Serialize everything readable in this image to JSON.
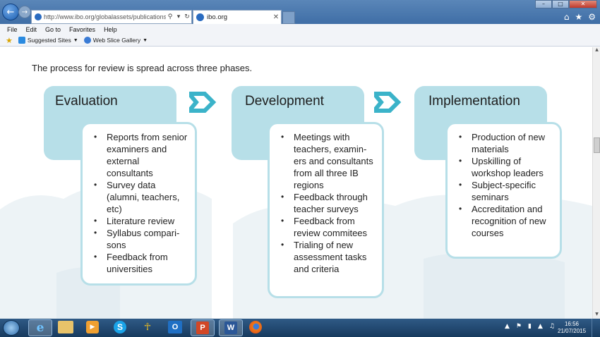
{
  "browser": {
    "url": "http://www.ibo.org/globalassets/publications/recogn",
    "url_host": "ibo.org",
    "tab_title": "ibo.org",
    "menu": [
      "File",
      "Edit",
      "Go to",
      "Favorites",
      "Help"
    ],
    "favorites": [
      {
        "label": "Suggested Sites",
        "icon": "suggested-sites-icon"
      },
      {
        "label": "Web Slice Gallery",
        "icon": "web-slice-icon"
      }
    ]
  },
  "page": {
    "intro": "The process for review is spread across three phases.",
    "phases": [
      {
        "title": "Evaluation",
        "items": [
          "Reports from senior examiners and external consultants",
          "Survey data (alumni, teachers, etc)",
          "Literature review",
          "Syllabus compari­sons",
          "Feedback from universities"
        ]
      },
      {
        "title": "Development",
        "items": [
          "Meetings with teachers, examin­ers and consul­tants from all three IB regions",
          "Feedback through teacher surveys",
          "Feedback from review commi­tees",
          "Trialing of new assessment tasks and criteria"
        ]
      },
      {
        "title": "Implementation",
        "items": [
          "Production of new materials",
          "Upskilling of workshop leaders",
          "Subject-specific seminars",
          "Accreditation and recognition of new courses"
        ]
      }
    ]
  },
  "taskbar": {
    "time": "16:56",
    "date": "21/07/2015",
    "apps": [
      "ie-icon",
      "file-explorer-icon",
      "media-player-icon",
      "skype-icon",
      "network-icon",
      "outlook-icon",
      "powerpoint-icon",
      "word-icon",
      "firefox-icon"
    ]
  },
  "colors": {
    "phase_fill": "#b7dfe8",
    "arrow": "#3bb3c9",
    "taskbar": "#1c3f66"
  }
}
